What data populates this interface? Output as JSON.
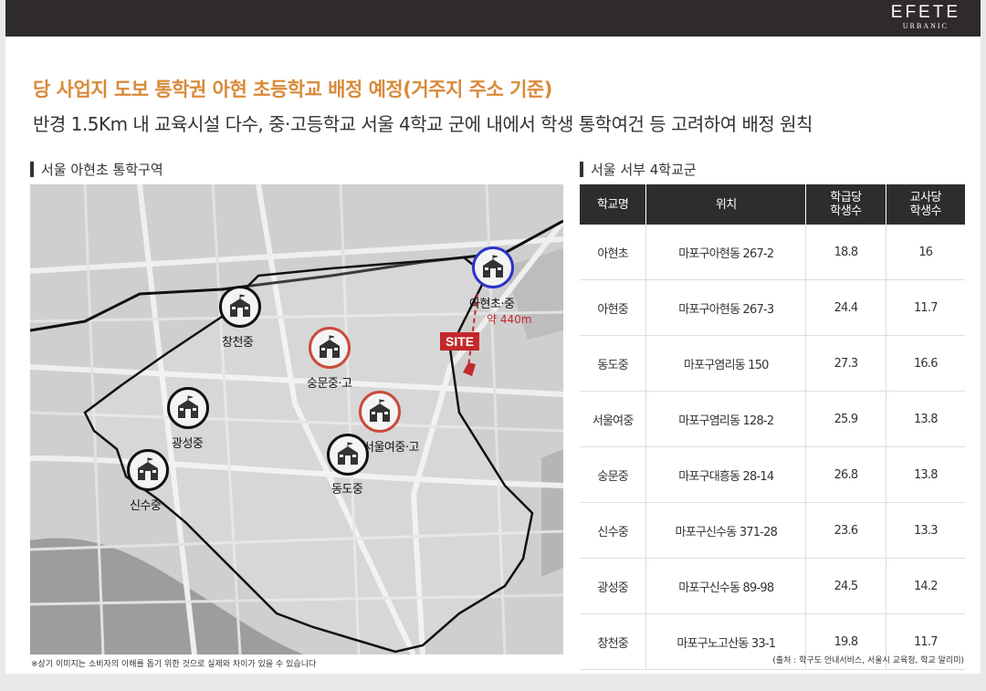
{
  "brand": {
    "name": "EFETE",
    "sub": "URBANIC"
  },
  "title": "당 사업지 도보 통학권 아현 초등학교 배정 예정(거주지 주소 기준)",
  "subtitle": "반경 1.5Km 내 교육시설 다수, 중·고등학교 서울 4학교 군에 내에서 학생 통학여건 등 고려하여 배정 원칙",
  "map_section": {
    "heading": "서울 아현초 통학구역",
    "site_label": "SITE",
    "distance_label": "약 440m",
    "schools": [
      {
        "name": "아현초·중",
        "ring": "blue"
      },
      {
        "name": "창천중",
        "ring": "black"
      },
      {
        "name": "숭문중·고",
        "ring": "red"
      },
      {
        "name": "광성중",
        "ring": "black"
      },
      {
        "name": "서울여중·고",
        "ring": "red"
      },
      {
        "name": "동도중",
        "ring": "black"
      },
      {
        "name": "신수중",
        "ring": "black"
      }
    ],
    "ring_colors": {
      "black": "#111111",
      "red": "#c94a3a",
      "blue": "#2b34c9"
    },
    "note": "※상기 이미지는 소비자의 이해를 돕기 위한 것으로 실제와 차이가 있을 수 있습니다"
  },
  "table_section": {
    "heading": "서울 서부 4학교군",
    "headers": [
      "학교명",
      "위치",
      "학급당\n학생수",
      "교사당\n학생수"
    ],
    "rows": [
      [
        "아현초",
        "마포구아현동 267-2",
        "18.8",
        "16"
      ],
      [
        "아현중",
        "마포구아현동 267-3",
        "24.4",
        "11.7"
      ],
      [
        "동도중",
        "마포구염리동 150",
        "27.3",
        "16.6"
      ],
      [
        "서울여중",
        "마포구염리동 128-2",
        "25.9",
        "13.8"
      ],
      [
        "숭문중",
        "마포구대흥동 28-14",
        "26.8",
        "13.8"
      ],
      [
        "신수중",
        "마포구신수동 371-28",
        "23.6",
        "13.3"
      ],
      [
        "광성중",
        "마포구신수동 89-98",
        "24.5",
        "14.2"
      ],
      [
        "창천중",
        "마포구노고산동 33-1",
        "19.8",
        "11.7"
      ]
    ],
    "source": "(출처 : 학구도 안내서비스, 서울시 교육청, 학교 알리미)"
  },
  "accent_colors": {
    "title": "#d98a3a",
    "site": "#c3282b",
    "table_header": "#2d2d2d"
  }
}
